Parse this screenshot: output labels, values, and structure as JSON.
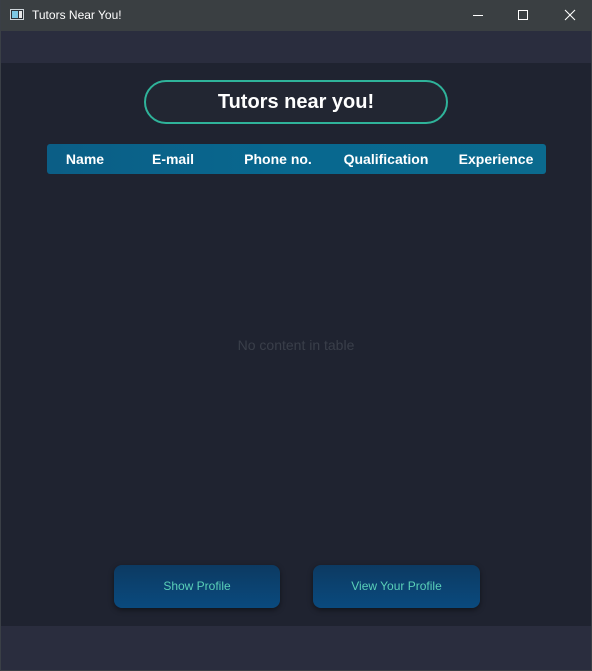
{
  "window": {
    "title": "Tutors Near You!"
  },
  "heading": "Tutors near you!",
  "table": {
    "columns": [
      "Name",
      "E-mail",
      "Phone no.",
      "Qualification",
      "Experience"
    ],
    "rows": [],
    "empty_message": "No content in table"
  },
  "buttons": {
    "show_profile": "Show Profile",
    "view_your_profile": "View Your Profile"
  },
  "colors": {
    "background": "#1f2330",
    "accent_border": "#2fb39a",
    "header_bar": "#08688f",
    "button_text": "#5ad0b8"
  },
  "icons": {
    "app": "app-window-icon",
    "minimize": "minimize-icon",
    "maximize": "maximize-icon",
    "close": "close-icon"
  }
}
